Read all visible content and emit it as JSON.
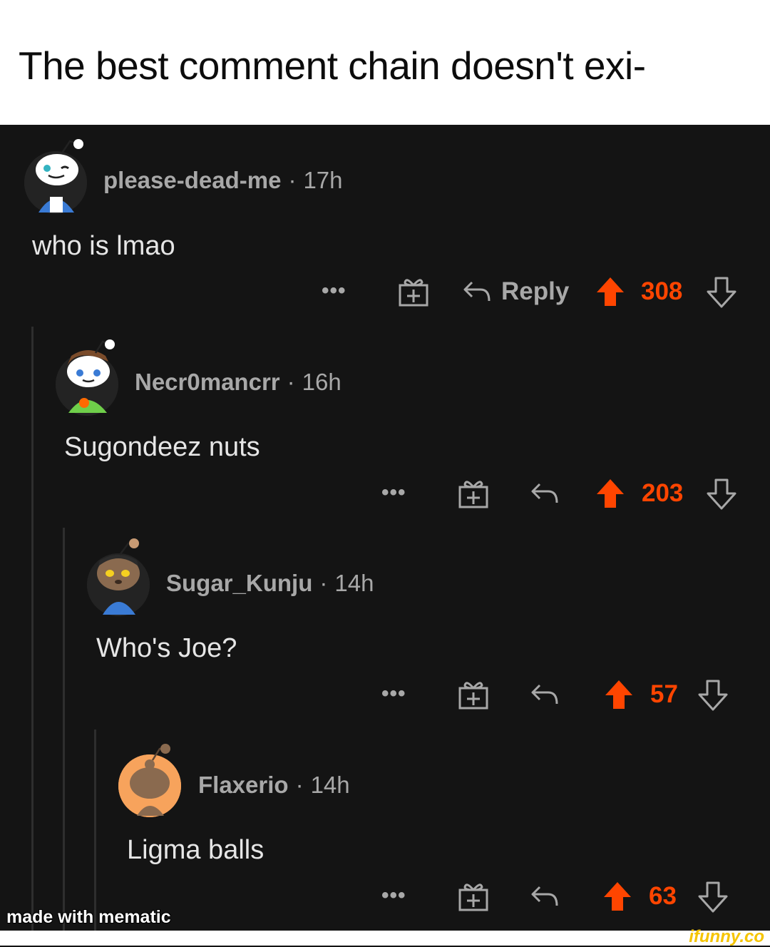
{
  "caption": {
    "text": "The best comment chain doesn't exi-"
  },
  "comments": [
    {
      "username": "please-dead-me",
      "separator": "·",
      "age": "17h",
      "body": "who is lmao",
      "more": "•••",
      "reply_label": "Reply",
      "score": "308",
      "avatar_icon": "snoo-avatar-white-hoodie"
    },
    {
      "username": "Necr0mancrr",
      "separator": "·",
      "age": "16h",
      "body": "Sugondeez nuts",
      "more": "•••",
      "reply_label": "",
      "score": "203",
      "avatar_icon": "snoo-avatar-brown-hair"
    },
    {
      "username": "Sugar_Kunju",
      "separator": "·",
      "age": "14h",
      "body": "Who's Joe?",
      "more": "•••",
      "reply_label": "",
      "score": "57",
      "avatar_icon": "snoo-avatar-brown-face"
    },
    {
      "username": "Flaxerio",
      "separator": "·",
      "age": "14h",
      "body": "Ligma balls",
      "more": "•••",
      "reply_label": "",
      "score": "63",
      "avatar_icon": "snoo-avatar-peach"
    }
  ],
  "colors": {
    "upvote": "#ff4500",
    "background": "#141414",
    "muted": "#a8a8a8"
  },
  "watermarks": {
    "mematic": "made with mematic",
    "ifunny": "ifunny.co"
  }
}
